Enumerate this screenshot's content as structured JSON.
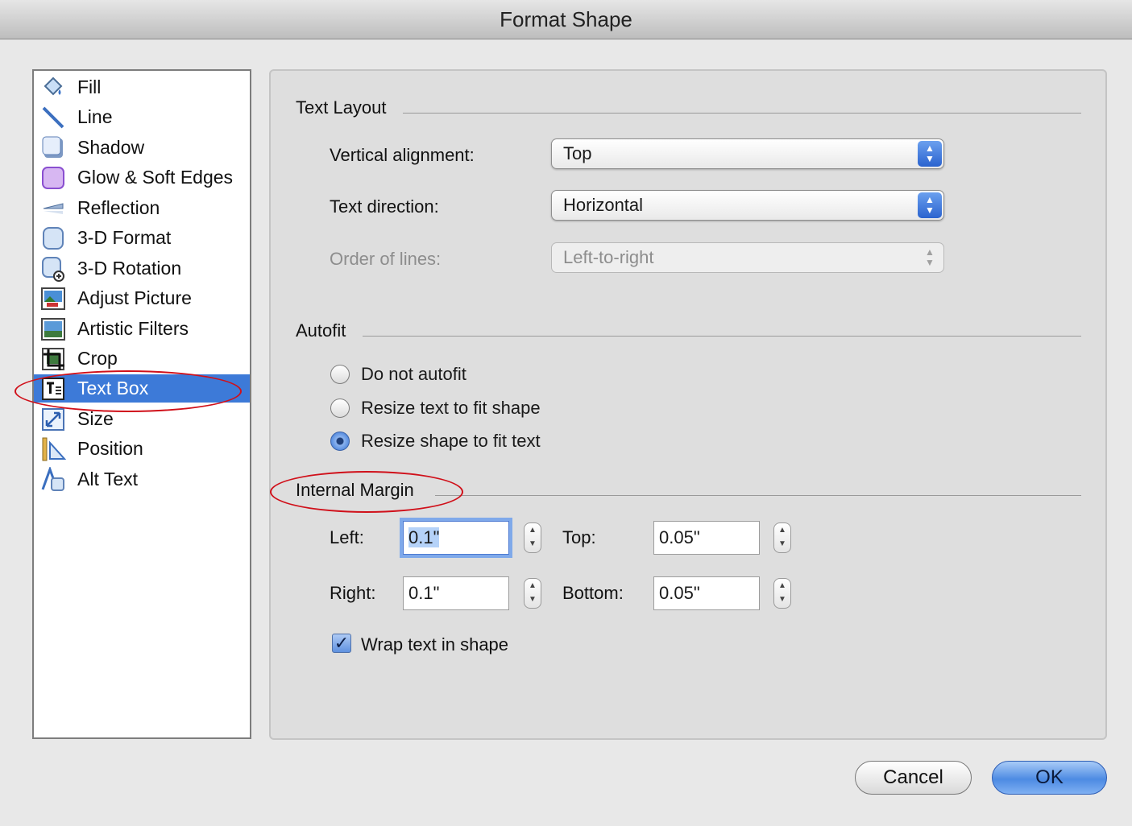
{
  "window": {
    "title": "Format Shape"
  },
  "sidebar": {
    "items": [
      {
        "label": "Fill",
        "icon": "paint-bucket-icon"
      },
      {
        "label": "Line",
        "icon": "line-icon"
      },
      {
        "label": "Shadow",
        "icon": "shadow-icon"
      },
      {
        "label": "Glow & Soft Edges",
        "icon": "glow-icon"
      },
      {
        "label": "Reflection",
        "icon": "reflection-icon"
      },
      {
        "label": "3-D Format",
        "icon": "cube-icon"
      },
      {
        "label": "3-D Rotation",
        "icon": "rotation-icon"
      },
      {
        "label": "Adjust Picture",
        "icon": "picture-icon"
      },
      {
        "label": "Artistic Filters",
        "icon": "filter-icon"
      },
      {
        "label": "Crop",
        "icon": "crop-icon"
      },
      {
        "label": "Text Box",
        "icon": "text-box-icon",
        "selected": true
      },
      {
        "label": "Size",
        "icon": "resize-icon"
      },
      {
        "label": "Position",
        "icon": "position-icon"
      },
      {
        "label": "Alt Text",
        "icon": "alt-text-icon"
      }
    ]
  },
  "text_layout": {
    "title": "Text Layout",
    "vertical_alignment": {
      "label": "Vertical alignment:",
      "value": "Top"
    },
    "text_direction": {
      "label": "Text direction:",
      "value": "Horizontal"
    },
    "order_of_lines": {
      "label": "Order of lines:",
      "value": "Left-to-right",
      "disabled": true
    }
  },
  "autofit": {
    "title": "Autofit",
    "options": [
      {
        "label": "Do not autofit",
        "checked": false
      },
      {
        "label": "Resize text to fit shape",
        "checked": false
      },
      {
        "label": "Resize shape to fit text",
        "checked": true
      }
    ]
  },
  "internal_margin": {
    "title": "Internal Margin",
    "left": {
      "label": "Left:",
      "value": "0.1\""
    },
    "top": {
      "label": "Top:",
      "value": "0.05\""
    },
    "right": {
      "label": "Right:",
      "value": "0.1\""
    },
    "bottom": {
      "label": "Bottom:",
      "value": "0.05\""
    }
  },
  "wrap_text": {
    "label": "Wrap text in shape",
    "checked": true
  },
  "buttons": {
    "cancel": "Cancel",
    "ok": "OK"
  },
  "colors": {
    "selection": "#3d7ad8",
    "annotation": "#d0101a",
    "accent": "#4d8be3"
  }
}
